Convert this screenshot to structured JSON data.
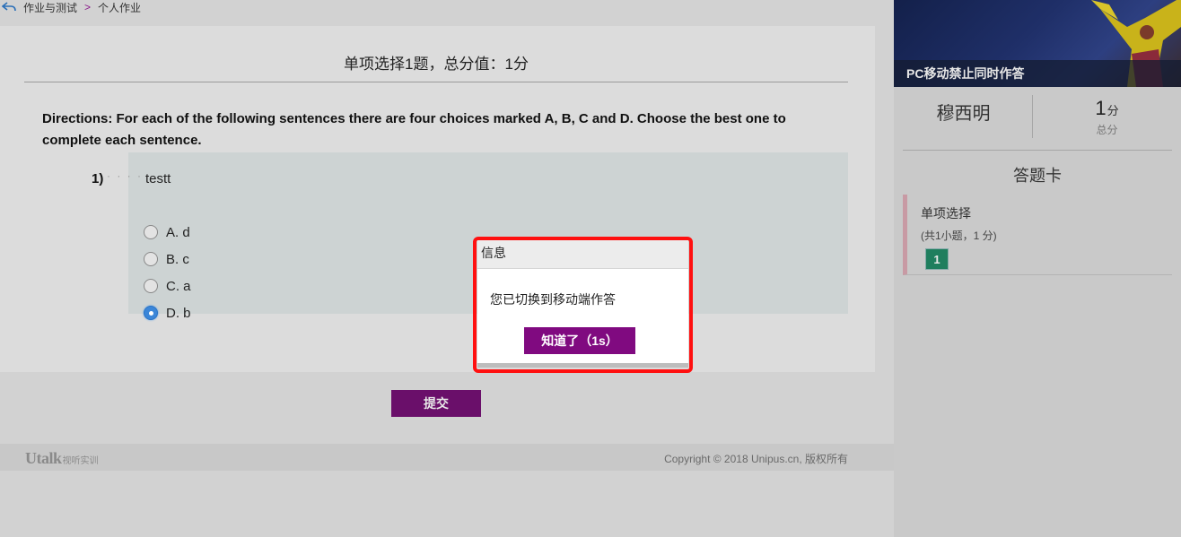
{
  "breadcrumb": {
    "items": [
      "作业与测试",
      "个人作业"
    ],
    "separator": ">"
  },
  "card": {
    "title": "单项选择1题，总分值：1分",
    "directions": "Directions: For each of the following sentences there are four choices marked A, B, C and D. Choose the best one to complete each sentence."
  },
  "question": {
    "number": "1)",
    "dots": "· · · ·",
    "text": "testt",
    "options": [
      {
        "label": "A. d",
        "checked": false
      },
      {
        "label": "B. c",
        "checked": false
      },
      {
        "label": "C. a",
        "checked": false
      },
      {
        "label": "D. b",
        "checked": true
      }
    ]
  },
  "submit_label": "提交",
  "footer": {
    "logo_main": "Utalk",
    "logo_sub": "视听实训",
    "copyright": "Copyright © 2018 Unipus.cn, 版权所有"
  },
  "sidebar": {
    "banner_caption": "PC移动禁止同时作答",
    "user_name": "穆西明",
    "score_value": "1",
    "score_unit": "分",
    "score_label": "总分",
    "card_heading": "答题卡",
    "section_title": "单项选择",
    "section_info": "(共1小题，1 分)",
    "answer_cells": [
      "1"
    ]
  },
  "dialog": {
    "title": "信息",
    "message": "您已切换到移动端作答",
    "button_label": "知道了（1s）"
  },
  "colors": {
    "accent_purple": "#800a80",
    "answered_green": "#1f7e5e",
    "highlight_red": "#ff1010",
    "radio_blue": "#3b86d8"
  }
}
